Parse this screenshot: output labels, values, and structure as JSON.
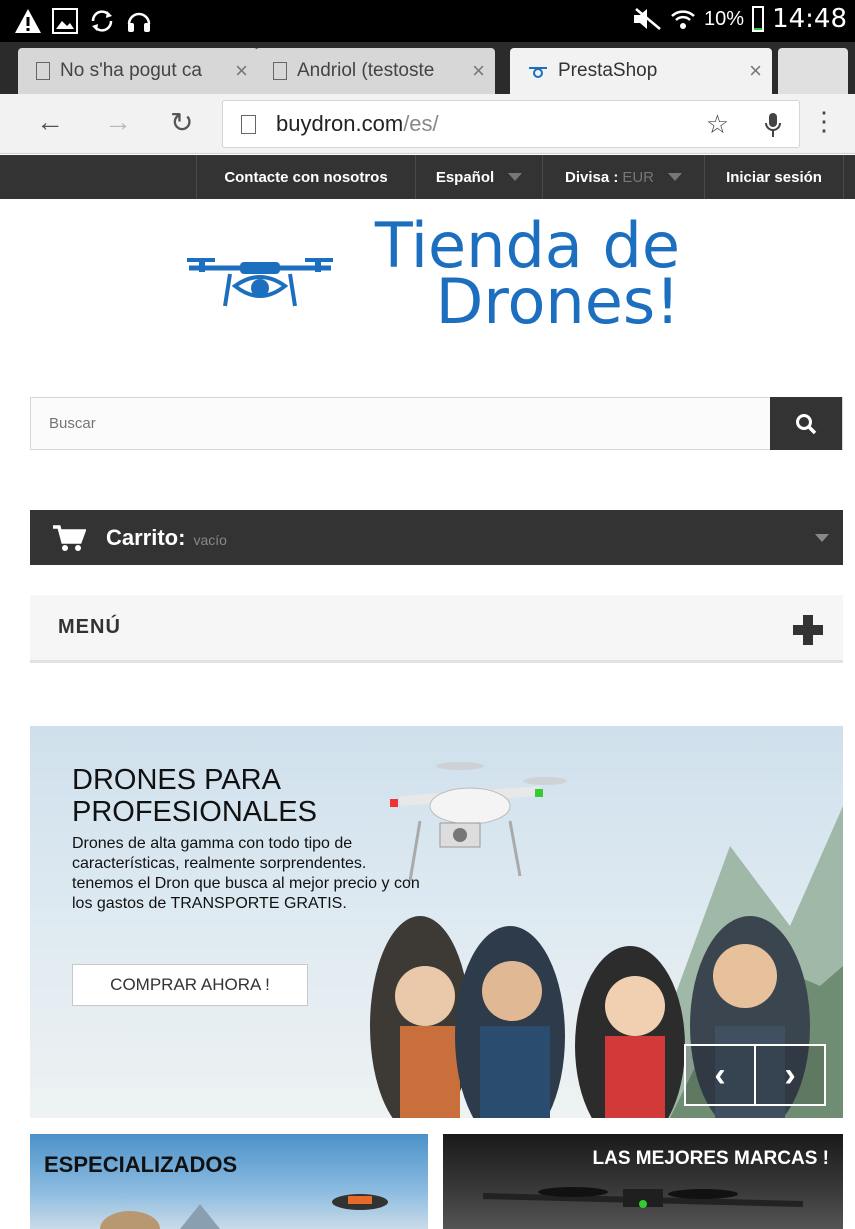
{
  "status_bar": {
    "battery": "10%",
    "time": "14:48"
  },
  "tabs": [
    {
      "title": "No s'ha pogut ca",
      "close": "×"
    },
    {
      "title": "Andriol (testoste",
      "close": "×"
    },
    {
      "title": "PrestaShop",
      "close": "×"
    }
  ],
  "omnibox": {
    "domain": "buydron.com",
    "path": "/es/"
  },
  "site_nav": {
    "contact": "Contacte con nosotros",
    "language": "Español",
    "currency_label": "Divisa :",
    "currency_value": "EUR",
    "login": "Iniciar sesión"
  },
  "logo": {
    "line1": "Tienda de",
    "line2": "Drones!"
  },
  "search": {
    "placeholder": "Buscar"
  },
  "cart": {
    "label": "Carrito:",
    "status": "vacío"
  },
  "menu": {
    "label": "MENÚ"
  },
  "hero": {
    "title": "DRONES PARA PROFESIONALES",
    "description": "Drones de alta gamma con todo tipo de características, realmente sorprendentes. tenemos el Dron que busca al mejor precio y con los gastos de TRANSPORTE GRATIS.",
    "button": "COMPRAR AHORA !"
  },
  "banners": {
    "left_title": "ESPECIALIZADOS",
    "right_title": "LAS MEJORES MARCAS !"
  },
  "colors": {
    "brand_blue": "#1c6fbe",
    "dark_bar": "#333333"
  }
}
